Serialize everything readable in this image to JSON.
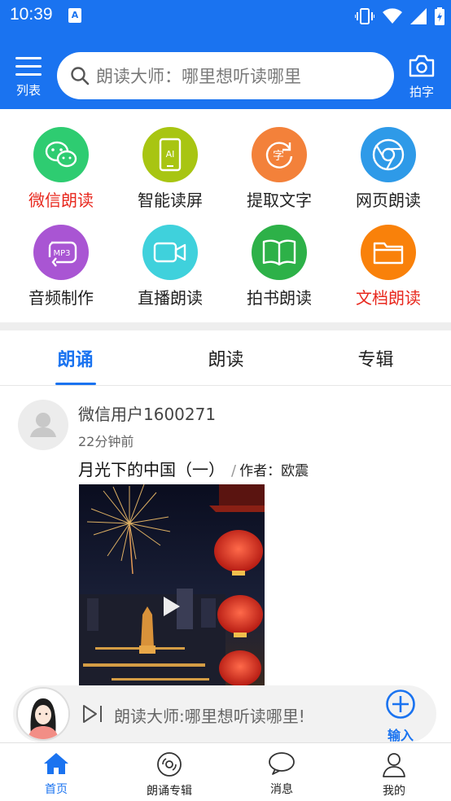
{
  "status_bar": {
    "time": "10:39",
    "app_badge": "A"
  },
  "header": {
    "menu_label": "列表",
    "search_placeholder": "朗读大师：哪里想听读哪里",
    "camera_label": "拍字"
  },
  "grid": [
    {
      "label": "微信朗读",
      "icon": "wechat-icon",
      "color": "#2ecc71",
      "highlight": true
    },
    {
      "label": "智能读屏",
      "icon": "ai-phone-icon",
      "color": "#a8c512",
      "highlight": false
    },
    {
      "label": "提取文字",
      "icon": "extract-text-icon",
      "color": "#f3813a",
      "highlight": false
    },
    {
      "label": "网页朗读",
      "icon": "browser-icon",
      "color": "#2e9ae8",
      "highlight": false
    },
    {
      "label": "音频制作",
      "icon": "mp3-icon",
      "color": "#a955d3",
      "highlight": false
    },
    {
      "label": "直播朗读",
      "icon": "video-camera-icon",
      "color": "#3fd1dc",
      "highlight": false
    },
    {
      "label": "拍书朗读",
      "icon": "book-icon",
      "color": "#2db148",
      "highlight": false
    },
    {
      "label": "文档朗读",
      "icon": "folder-icon",
      "color": "#f9810a",
      "highlight": true
    }
  ],
  "tabs": [
    {
      "label": "朗诵",
      "active": true
    },
    {
      "label": "朗读",
      "active": false
    },
    {
      "label": "专辑",
      "active": false
    }
  ],
  "post": {
    "username": "微信用户1600271",
    "time": "22分钟前",
    "title": "月光下的中国（一）",
    "separator": "/",
    "author": "作者：欧震"
  },
  "player": {
    "text": "朗读大师:哪里想听读哪里!",
    "input_label": "输入"
  },
  "bottom_nav": [
    {
      "label": "首页",
      "icon": "home-icon",
      "active": true
    },
    {
      "label": "朗诵专辑",
      "icon": "disc-icon",
      "active": false
    },
    {
      "label": "消息",
      "icon": "message-icon",
      "active": false
    },
    {
      "label": "我的",
      "icon": "user-icon",
      "active": false
    }
  ],
  "colors": {
    "primary": "#1a73f0",
    "highlight_text": "#e8281e"
  }
}
